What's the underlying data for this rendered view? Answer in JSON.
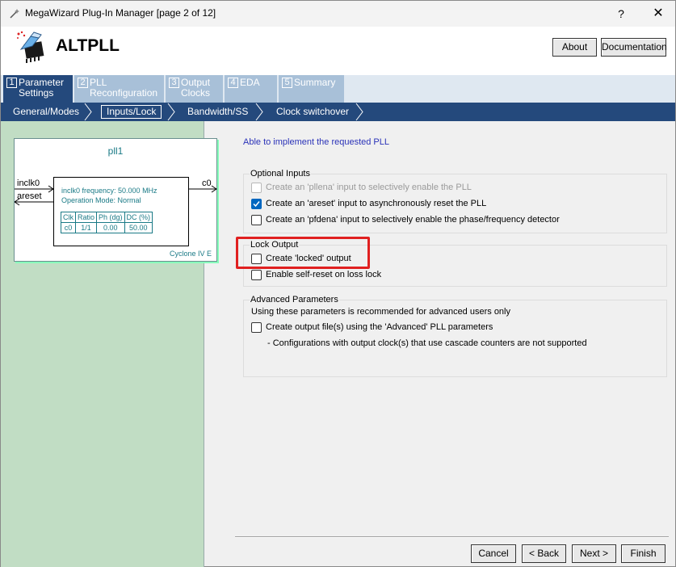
{
  "window": {
    "title": "MegaWizard Plug-In Manager [page 2 of 12]",
    "help_label": "?",
    "close_label": "✕"
  },
  "header": {
    "product": "ALTPLL",
    "about_label": "About",
    "documentation_label": "Documentation"
  },
  "tabs": [
    {
      "num": "1",
      "label": "Parameter\nSettings",
      "active": true
    },
    {
      "num": "2",
      "label": "PLL\nReconfiguration",
      "active": false
    },
    {
      "num": "3",
      "label": "Output\nClocks",
      "active": false
    },
    {
      "num": "4",
      "label": "EDA",
      "active": false
    },
    {
      "num": "5",
      "label": "Summary",
      "active": false
    }
  ],
  "subtabs": [
    {
      "label": "General/Modes",
      "active": false
    },
    {
      "label": "Inputs/Lock",
      "active": true
    },
    {
      "label": "Bandwidth/SS",
      "active": false
    },
    {
      "label": "Clock switchover",
      "active": false
    }
  ],
  "block": {
    "name": "pll1",
    "in_clk": "inclk0",
    "in_reset": "areset",
    "out_clk": "c0",
    "freq_line": "inclk0 frequency: 50.000 MHz",
    "mode_line": "Operation Mode: Normal",
    "table_headers": [
      "Clk",
      "Ratio",
      "Ph (dg)",
      "DC (%)"
    ],
    "table_row": [
      "c0",
      "1/1",
      "0.00",
      "50.00"
    ],
    "family": "Cyclone IV E"
  },
  "status": "Able to implement the requested PLL",
  "optional_inputs": {
    "title": "Optional Inputs",
    "options": [
      {
        "label": "Create an 'pllena' input to selectively enable the PLL",
        "checked": false,
        "disabled": true
      },
      {
        "label": "Create an 'areset' input to asynchronously reset the PLL",
        "checked": true,
        "disabled": false
      },
      {
        "label": "Create an 'pfdena' input to selectively enable the phase/frequency detector",
        "checked": false,
        "disabled": false
      }
    ]
  },
  "lock_output": {
    "title": "Lock Output",
    "options": [
      {
        "label": "Create 'locked' output",
        "checked": false
      },
      {
        "label": "Enable self-reset on loss lock",
        "checked": false
      }
    ]
  },
  "advanced": {
    "title": "Advanced Parameters",
    "note": "Using these parameters is recommended for advanced users only",
    "option_label": "Create output file(s) using the 'Advanced' PLL parameters",
    "sub_note": "- Configurations with output clock(s) that use cascade counters are not supported"
  },
  "buttons": {
    "cancel": "Cancel",
    "back": "< Back",
    "next": "Next >",
    "finish": "Finish"
  },
  "colors": {
    "active_tab": "#24497c",
    "inactive_tab": "#a8c0d8",
    "left_panel": "#c1ddc4",
    "status_text": "#2a32b8",
    "highlight": "#e02020"
  }
}
